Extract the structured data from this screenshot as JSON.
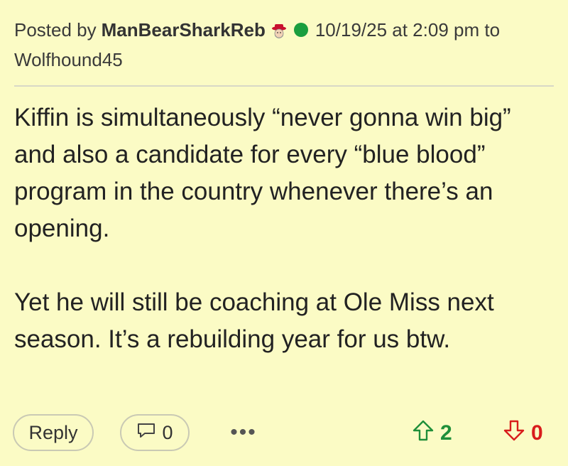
{
  "post": {
    "posted_by_label": "Posted by",
    "author": "ManBearSharkReb",
    "author_badge_icon": "rebel-mascot-badge-icon",
    "online_status_color": "#1a9e3f",
    "timestamp_text": "10/19/25 at 2:09 pm to",
    "reply_to": "Wolfhound45",
    "body_paragraphs": [
      "Kiffin is simultaneously “never gonna win big” and also a candidate for every “blue blood” program in the country whenever there’s an opening.",
      "Yet he will still be coaching at Ole Miss next season. It’s a rebuilding year for us btw."
    ]
  },
  "actions": {
    "reply_label": "Reply",
    "comment_count": "0",
    "more_label": "•••",
    "upvote_count": "2",
    "downvote_count": "0",
    "upvote_color": "#1f8f3a",
    "downvote_color": "#d81c1c"
  },
  "theme": {
    "background": "#fbfbc5"
  }
}
